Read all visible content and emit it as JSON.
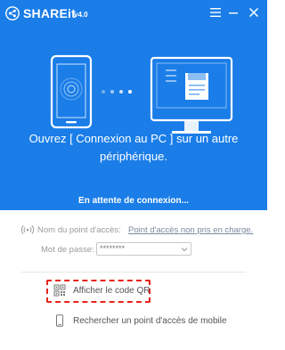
{
  "app": {
    "name": "SHAREit",
    "version": "v4.0"
  },
  "titlebar": {
    "menu_icon": "hamburger-menu-icon",
    "minimize_icon": "minimize-icon",
    "close_icon": "close-icon"
  },
  "colors": {
    "header_blue": "#1a7de8",
    "qr_highlight": "#e8231b",
    "link_gray": "#7a8aa0"
  },
  "main": {
    "message": "Ouvrez [ Connexion au PC ] sur un autre périphérique.",
    "status": "En attente de connexion..."
  },
  "hotspot": {
    "label": "Nom du point d'accès:",
    "value": "Point d'accès non pris en charge."
  },
  "password": {
    "label": "Mot de passe:",
    "value": "********"
  },
  "actions": {
    "qr_label": "Afficher le code QR",
    "mobile_label": "Rechercher un point d'accès de mobile"
  }
}
